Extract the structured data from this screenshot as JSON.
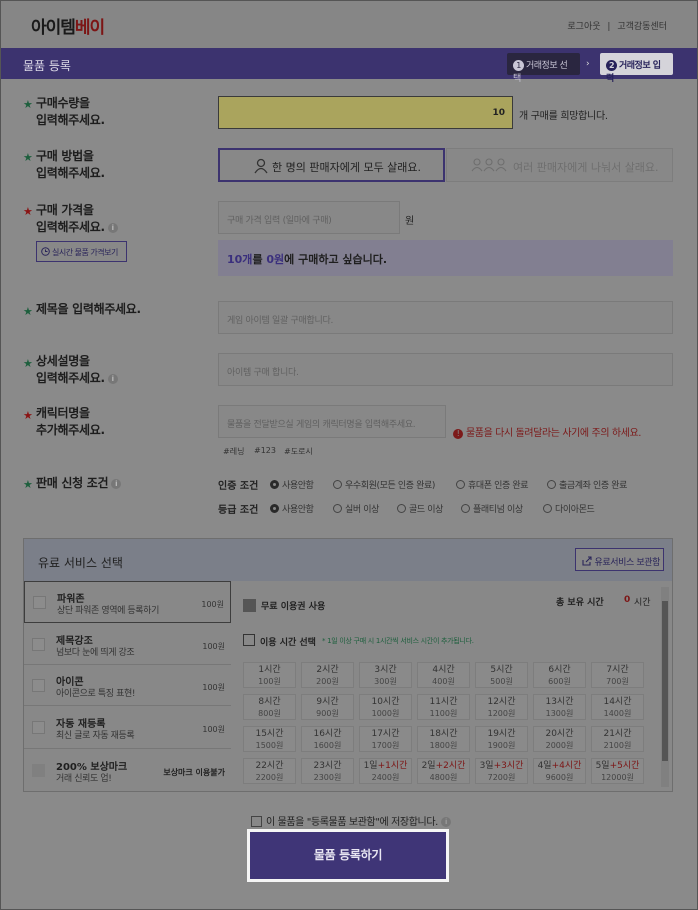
{
  "header": {
    "logo_part1": "아이템",
    "logo_part2": "베이",
    "links": [
      "로그아웃",
      "|",
      "고객감동센터"
    ]
  },
  "titlebar": {
    "title": "물품 등록",
    "step1_num": "1",
    "step1": "거래정보 선택",
    "step2_num": "2",
    "step2": "거래정보 입력",
    "arrow": "›"
  },
  "quantity": {
    "label_line1": "구매수량을",
    "label_line2": "입력해주세요.",
    "value": "10",
    "suffix": "개 구매를 희망합니다."
  },
  "method": {
    "label_line1": "구매 방법을",
    "label_line2": "입력해주세요.",
    "option1": "한 명의 판매자에게 모두 살래요.",
    "option2": "여러 판매자에게 나눠서 살래요."
  },
  "price": {
    "label_line1": "구매 가격을",
    "label_line2": "입력해주세요.",
    "placeholder": "구매 가격 입력 (일마에 구매)",
    "unit": "원",
    "realtime_button": "실시간 물품 가격보기",
    "summary_prefix_qty": "10개",
    "summary_mid": "를 ",
    "summary_price": "0원",
    "summary_suffix": "에 구매하고 싶습니다."
  },
  "title_field": {
    "label": "제목을 입력해주세요.",
    "placeholder": "게임 아이템 일괄 구매합니다."
  },
  "description": {
    "label_line1": "상세설명을",
    "label_line2": "입력해주세요.",
    "placeholder": "아이템 구매 합니다."
  },
  "character": {
    "label_line1": "캐릭터명을",
    "label_line2": "추가해주세요.",
    "placeholder": "물품을 전달받으실 게임의 캐릭터명을 입력해주세요.",
    "tags": [
      "#레닝",
      "#123",
      "#도로시"
    ],
    "warning": "물품을 다시 돌려달라는 사기에 주의 하세요."
  },
  "conditions": {
    "label": "판매 신청 조건",
    "auth_label": "인증 조건",
    "auth_options": [
      "사용안함",
      "우수회원(모든 인증 완료)",
      "휴대폰 인증 완료",
      "출금계좌 인증 완료"
    ],
    "grade_label": "등급 조건",
    "grade_options": [
      "사용안함",
      "실버 이상",
      "골드 이상",
      "플래티넘 이상",
      "다이아몬드"
    ]
  },
  "paid": {
    "title": "유료 서비스 선택",
    "save_button": "유료서비스 보관함",
    "services": [
      {
        "name": "파워존",
        "desc": "상단 파워존 영역에 등록하기",
        "price": "100원"
      },
      {
        "name": "제목강조",
        "desc": "넘보다 눈에 띄게 강조",
        "price": "100원"
      },
      {
        "name": "아이콘",
        "desc": "아이콘으로 특징 표현!",
        "price": "100원"
      },
      {
        "name": "자동 재등록",
        "desc": "최신 글로 자동 재등록",
        "price": "100원"
      },
      {
        "name": "200% 보상마크",
        "desc": "거래 신뢰도 업!",
        "price": "보상마크 이용불가"
      }
    ],
    "free_use": "무료 이용권 사용",
    "total_time_label": "총 보유 시간",
    "total_time_value": "0",
    "total_time_unit": "시간",
    "time_select": "이용 시간 선택",
    "time_note": "* 1일 이상 구매 시 1시간씩 서비스 시간이 추가됩니다.",
    "time_options": [
      {
        "t": "1시간",
        "p": "100원"
      },
      {
        "t": "2시간",
        "p": "200원"
      },
      {
        "t": "3시간",
        "p": "300원"
      },
      {
        "t": "4시간",
        "p": "400원"
      },
      {
        "t": "5시간",
        "p": "500원"
      },
      {
        "t": "6시간",
        "p": "600원"
      },
      {
        "t": "7시간",
        "p": "700원"
      },
      {
        "t": "8시간",
        "p": "800원"
      },
      {
        "t": "9시간",
        "p": "900원"
      },
      {
        "t": "10시간",
        "p": "1000원"
      },
      {
        "t": "11시간",
        "p": "1100원"
      },
      {
        "t": "12시간",
        "p": "1200원"
      },
      {
        "t": "13시간",
        "p": "1300원"
      },
      {
        "t": "14시간",
        "p": "1400원"
      },
      {
        "t": "15시간",
        "p": "1500원"
      },
      {
        "t": "16시간",
        "p": "1600원"
      },
      {
        "t": "17시간",
        "p": "1700원"
      },
      {
        "t": "18시간",
        "p": "1800원"
      },
      {
        "t": "19시간",
        "p": "1900원"
      },
      {
        "t": "20시간",
        "p": "2000원"
      },
      {
        "t": "21시간",
        "p": "2100원"
      },
      {
        "t": "22시간",
        "p": "2200원"
      },
      {
        "t": "23시간",
        "p": "2300원"
      }
    ],
    "day_options": [
      {
        "d": "1일",
        "x": "+1시간",
        "p": "2400원"
      },
      {
        "d": "2일",
        "x": "+2시간",
        "p": "4800원"
      },
      {
        "d": "3일",
        "x": "+3시간",
        "p": "7200원"
      },
      {
        "d": "4일",
        "x": "+4시간",
        "p": "9600원"
      },
      {
        "d": "5일",
        "x": "+5시간",
        "p": "12000원"
      }
    ]
  },
  "footer": {
    "agree": "이 물품을 \"등록물품 보관함\"에 저장합니다.",
    "submit": "물품 등록하기"
  }
}
